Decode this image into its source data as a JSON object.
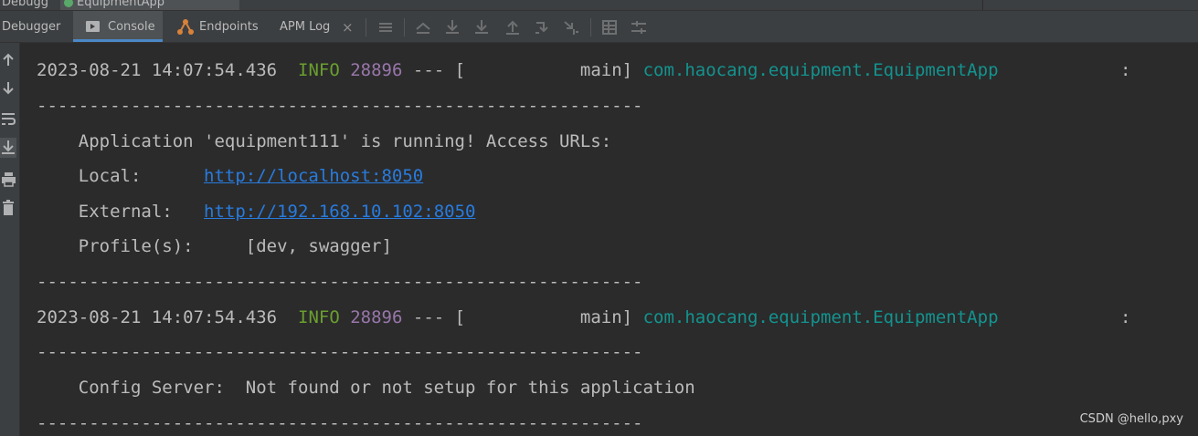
{
  "top_tabs": {
    "left": "Debugg",
    "active": "EquipmentApp"
  },
  "toolbar": {
    "debugger_label": "Debugger",
    "console_label": "Console",
    "endpoints_label": "Endpoints",
    "apm_label": "APM Log",
    "close_glyph": "×"
  },
  "icons": {
    "console": "console-icon",
    "endpoints": "endpoints-icon",
    "menu": "hamburger-icon",
    "up_stack": "up-stack-icon",
    "down_stack": "down-stack-icon",
    "step_into": "step-into-icon",
    "step_out": "step-out-icon",
    "run_to_cursor": "run-to-cursor-icon",
    "evaluate": "evaluate-icon",
    "table": "table-icon",
    "settings": "settings-icon",
    "scroll_up": "arrow-up-icon",
    "scroll_down": "arrow-down-icon",
    "soft_wrap": "soft-wrap-icon",
    "scroll_to_end": "scroll-to-end-icon",
    "print": "print-icon",
    "clear": "trash-icon"
  },
  "console": {
    "cut_line": "~~~~~~~~~~~~~~~~~~~~~~~~~~~~~~~~~~~~",
    "log1": {
      "timestamp": "2023-08-21 14:07:54.436",
      "level": "INFO",
      "pid": "28896",
      "sep": "---",
      "thread": "[           main]",
      "logger": "com.haocang.equipment.EquipmentApp",
      "colon": ":"
    },
    "dash_line": "----------------------------------------------------------",
    "app_running": "    Application 'equipment111' is running! Access URLs:",
    "local_label": "    Local:      ",
    "local_url": "http://localhost:8050",
    "external_label": "    External:   ",
    "external_url": "http://192.168.10.102:8050",
    "profile_label": "    Profile(s):     ",
    "profile_value": "[dev, swagger]",
    "log2": {
      "timestamp": "2023-08-21 14:07:54.436",
      "level": "INFO",
      "pid": "28896",
      "sep": "---",
      "thread": "[           main]",
      "logger": "com.haocang.equipment.EquipmentApp",
      "colon": ":"
    },
    "config_server": "    Config Server:  Not found or not setup for this application"
  },
  "watermark": "CSDN @hello,pxy",
  "colors": {
    "background": "#2b2b2b",
    "panel": "#3c3f41",
    "info": "#6a9f2f",
    "pid": "#9876aa",
    "logger": "#13938f",
    "link": "#287bde",
    "accent": "#4a88c7"
  }
}
